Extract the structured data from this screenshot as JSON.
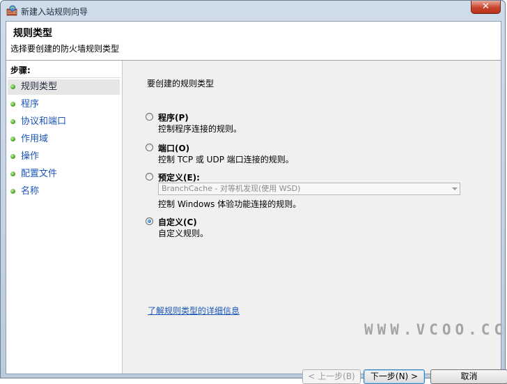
{
  "window": {
    "title": "新建入站规则向导",
    "close_glyph": "✕"
  },
  "header": {
    "title": "规则类型",
    "subtitle": "选择要创建的防火墙规则类型"
  },
  "sidebar": {
    "label": "步骤:",
    "items": [
      {
        "label": "规则类型",
        "active": true
      },
      {
        "label": "程序"
      },
      {
        "label": "协议和端口"
      },
      {
        "label": "作用域"
      },
      {
        "label": "操作"
      },
      {
        "label": "配置文件"
      },
      {
        "label": "名称"
      }
    ]
  },
  "main": {
    "prompt": "要创建的规则类型",
    "options": [
      {
        "label": "程序(P)",
        "desc": "控制程序连接的规则。",
        "checked": false
      },
      {
        "label": "端口(O)",
        "desc": "控制 TCP 或 UDP 端口连接的规则。",
        "checked": false
      },
      {
        "label": "预定义(E):",
        "select_value": "BranchCache - 对等机发现(使用 WSD)",
        "desc": "控制 Windows 体验功能连接的规则。",
        "checked": false
      },
      {
        "label": "自定义(C)",
        "desc": "自定义规则。",
        "checked": true
      }
    ],
    "help_link": "了解规则类型的详细信息",
    "watermark": "WWW.VCOO.CC"
  },
  "buttons": {
    "back": "< 上一步(B)",
    "next": "下一步(N) >",
    "cancel": "取消"
  },
  "colors": {
    "link": "#1a56b8",
    "accent_dot": "#3e9b1a"
  }
}
